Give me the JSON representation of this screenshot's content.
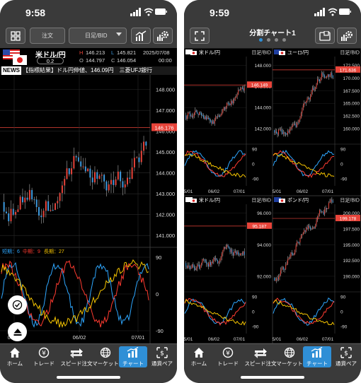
{
  "left": {
    "time": "9:58",
    "toolbar": {
      "order_label": "注文",
      "period_label": "日足/BID"
    },
    "pair": {
      "name": "米ドル/円",
      "spread": "0.2",
      "date": "2025/07/08",
      "clock": "00:00"
    },
    "ohlc": {
      "h_label": "H",
      "h": "146.213",
      "l_label": "L",
      "l": "145.821",
      "o_label": "O",
      "o": "144.797",
      "c_label": "C",
      "c": "146.054"
    },
    "news": {
      "badge": "NEWS",
      "text": "【指標結果】ドル円伸値、146.09円　三菱UFJ銀行"
    },
    "price_axis": [
      "148.000",
      "147.000",
      "146.000",
      "145.000",
      "144.000",
      "143.000",
      "142.000",
      "141.000"
    ],
    "current_price": "146.176",
    "osc_legend": {
      "short": "短期：6",
      "mid": "中期：9",
      "long": "長期：27"
    },
    "osc_axis": [
      "90",
      "0",
      "-90"
    ],
    "date_axis": [
      "05/01",
      "06/02",
      "07/01"
    ]
  },
  "right": {
    "time": "9:59",
    "title": "分割チャート1",
    "panels": [
      {
        "pair": "米ドル/円",
        "period": "日足/BID",
        "axis": [
          "148.000",
          "146.000",
          "144.000",
          "142.000"
        ],
        "price": "146.149"
      },
      {
        "pair": "ユーロ/円",
        "period": "日足/BID",
        "axis": [
          "172.500",
          "170.000",
          "167.500",
          "165.000",
          "162.500",
          "160.000"
        ],
        "price": "171.636"
      },
      {
        "pair": "米ドル/円",
        "period": "日足/BID",
        "axis": [
          "96.000",
          "94.000",
          "92.000"
        ],
        "price": "95.187"
      },
      {
        "pair": "ポンド/円",
        "period": "日足/BID",
        "axis": [
          "200.000",
          "197.500",
          "195.000",
          "192.500",
          "190.000"
        ],
        "price": "199.178"
      }
    ],
    "osc_axis": [
      "90",
      "0",
      "-90"
    ],
    "date_axis": [
      "5/01",
      "06/02",
      "07/01"
    ]
  },
  "nav": [
    "ホーム",
    "トレード",
    "スピード注文",
    "マーケット",
    "チャート",
    "通貨ペア"
  ],
  "colors": {
    "up": "#e8443a",
    "down": "#3d9be0",
    "accent": "#2f8fd6",
    "price_line": "#e8443a",
    "osc_short": "#2ea7ff",
    "osc_mid": "#ff3b30",
    "osc_long": "#f5c400"
  }
}
